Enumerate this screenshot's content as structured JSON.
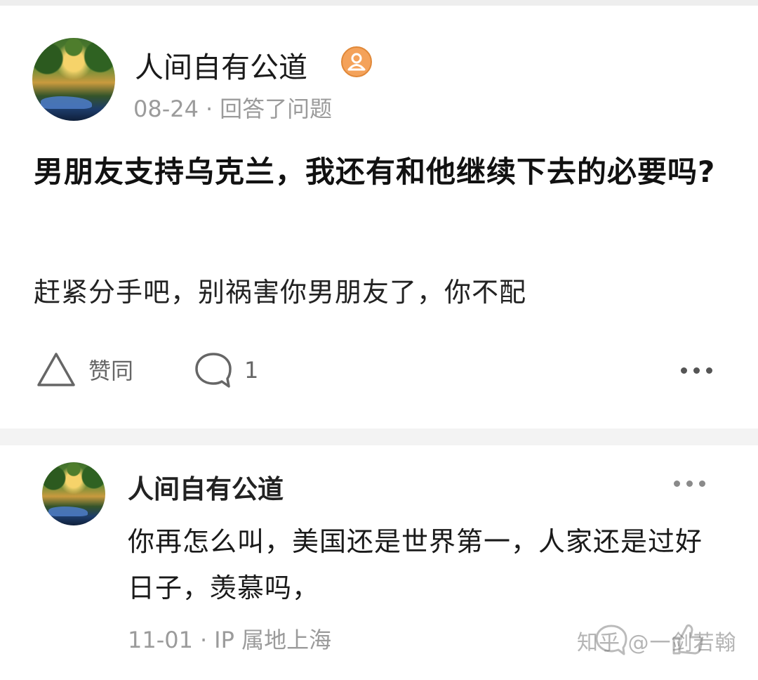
{
  "post": {
    "author": {
      "name": "人间自有公道",
      "badge_icon": "user-badge-icon",
      "badge_color": "#f4a25a"
    },
    "date": "08-24",
    "separator": "·",
    "action_text": "回答了问题",
    "question_title": "男朋友支持乌克兰，我还有和他继续下去的必要吗?",
    "answer": "赶紧分手吧，别祸害你男朋友了，你不配",
    "actions": {
      "upvote_label": "赞同",
      "upvote_icon": "triangle-up-icon",
      "comment_count": "1",
      "comment_icon": "comment-bubble-icon",
      "more_icon": "more-dots-icon"
    }
  },
  "comment": {
    "author_name": "人间自有公道",
    "text": "你再怎么叫，美国还是世界第一，人家还是过好日子，羡慕吗，",
    "date": "11-01",
    "separator": "·",
    "location": "IP 属地上海",
    "more_icon": "more-dots-icon"
  },
  "watermark": {
    "text": "知乎 @一剑若翰"
  },
  "colors": {
    "divider": "#f3f3f3",
    "meta_text": "#9b9b9b",
    "watermark": "#787878"
  }
}
